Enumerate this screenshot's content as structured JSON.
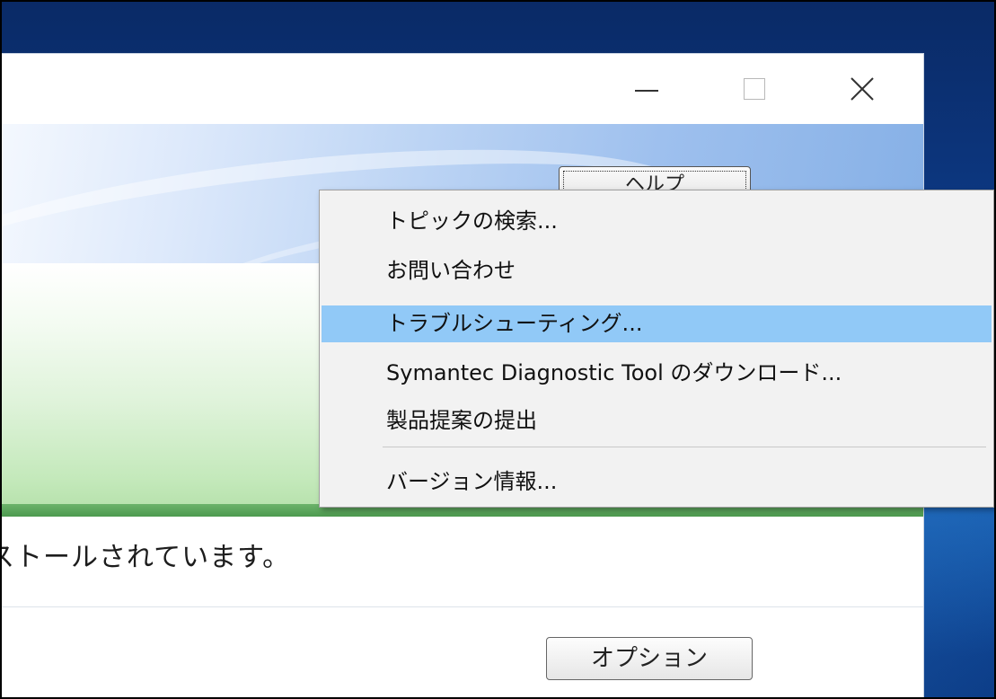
{
  "window": {
    "caption_buttons": {
      "minimize_icon": "minimize-icon",
      "maximize_icon": "maximize-icon",
      "close_icon": "close-icon"
    }
  },
  "banner": {
    "help_button_label": "ヘルプ"
  },
  "help_menu": {
    "items": [
      {
        "label": "トピックの検索..."
      },
      {
        "label": "お問い合わせ"
      },
      {
        "label": "トラブルシューティング...",
        "highlighted": true
      },
      {
        "label": "Symantec Diagnostic Tool のダウンロード..."
      },
      {
        "label": "製品提案の提出"
      },
      {
        "label": "バージョン情報..."
      }
    ]
  },
  "status": {
    "message": "ストールされています。"
  },
  "footer": {
    "options_button_label": "オプション"
  },
  "colors": {
    "menu_highlight": "#91c9f7",
    "status_strip": "#4d9a4f",
    "desktop": "#0d3a86"
  }
}
